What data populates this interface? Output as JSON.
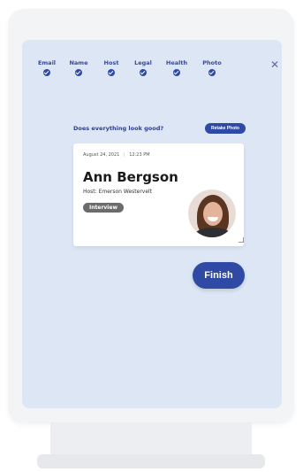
{
  "steps": [
    {
      "label": "Email",
      "status": "complete"
    },
    {
      "label": "Name",
      "status": "complete"
    },
    {
      "label": "Host",
      "status": "complete"
    },
    {
      "label": "Legal",
      "status": "complete"
    },
    {
      "label": "Health",
      "status": "complete"
    },
    {
      "label": "Photo",
      "status": "complete"
    }
  ],
  "review": {
    "question": "Does everything look good?",
    "retake_label": "Retake Photo"
  },
  "badge": {
    "date": "August 24, 2021",
    "time": "12:23 PM",
    "name": "Ann Bergson",
    "host": "Host: Emerson Westervelt",
    "tag": "Interview"
  },
  "actions": {
    "finish_label": "Finish"
  },
  "icons": {
    "close": "close-icon",
    "step_complete": "check-circle-icon",
    "resize": "resize-handle-icon"
  },
  "colors": {
    "accent": "#2f4aa4",
    "screen_bg": "#dce6f4",
    "tag_bg": "#6b6b6b"
  }
}
